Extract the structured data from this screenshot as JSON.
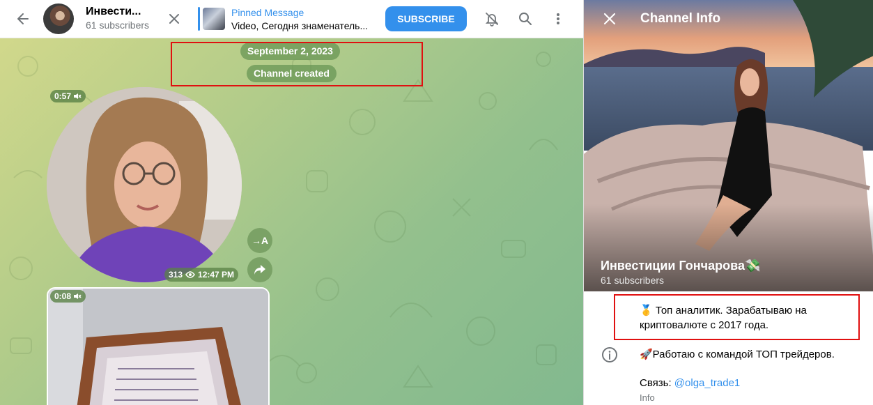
{
  "header": {
    "channel_title": "Инвести...",
    "channel_subtitle": "61 subscribers",
    "pinned_title": "Pinned Message",
    "pinned_text": "Video, Сегодня знаменатель...",
    "subscribe_label": "SUBSCRIBE"
  },
  "chat": {
    "date_pill": "September 2, 2023",
    "service_pill": "Channel created",
    "video1": {
      "duration": "0:57",
      "views": "313",
      "time": "12:47 PM"
    },
    "video2": {
      "duration": "0:08"
    },
    "translate_label": "→A"
  },
  "info_panel": {
    "title": "Channel Info",
    "channel_name": "Инвестиции Гончарова💸",
    "subscribers": "61 subscribers",
    "description_line1": "🥇 Топ аналитик. Зарабатываю на криптовалюте с 2017 года.",
    "description_line2": "🚀Работаю с командой ТОП трейдеров.",
    "contact_prefix": "Связь: ",
    "contact_handle": "@olga_trade1",
    "info_label": "Info"
  },
  "colors": {
    "accent": "#3390ec",
    "highlight": "#e01010"
  }
}
